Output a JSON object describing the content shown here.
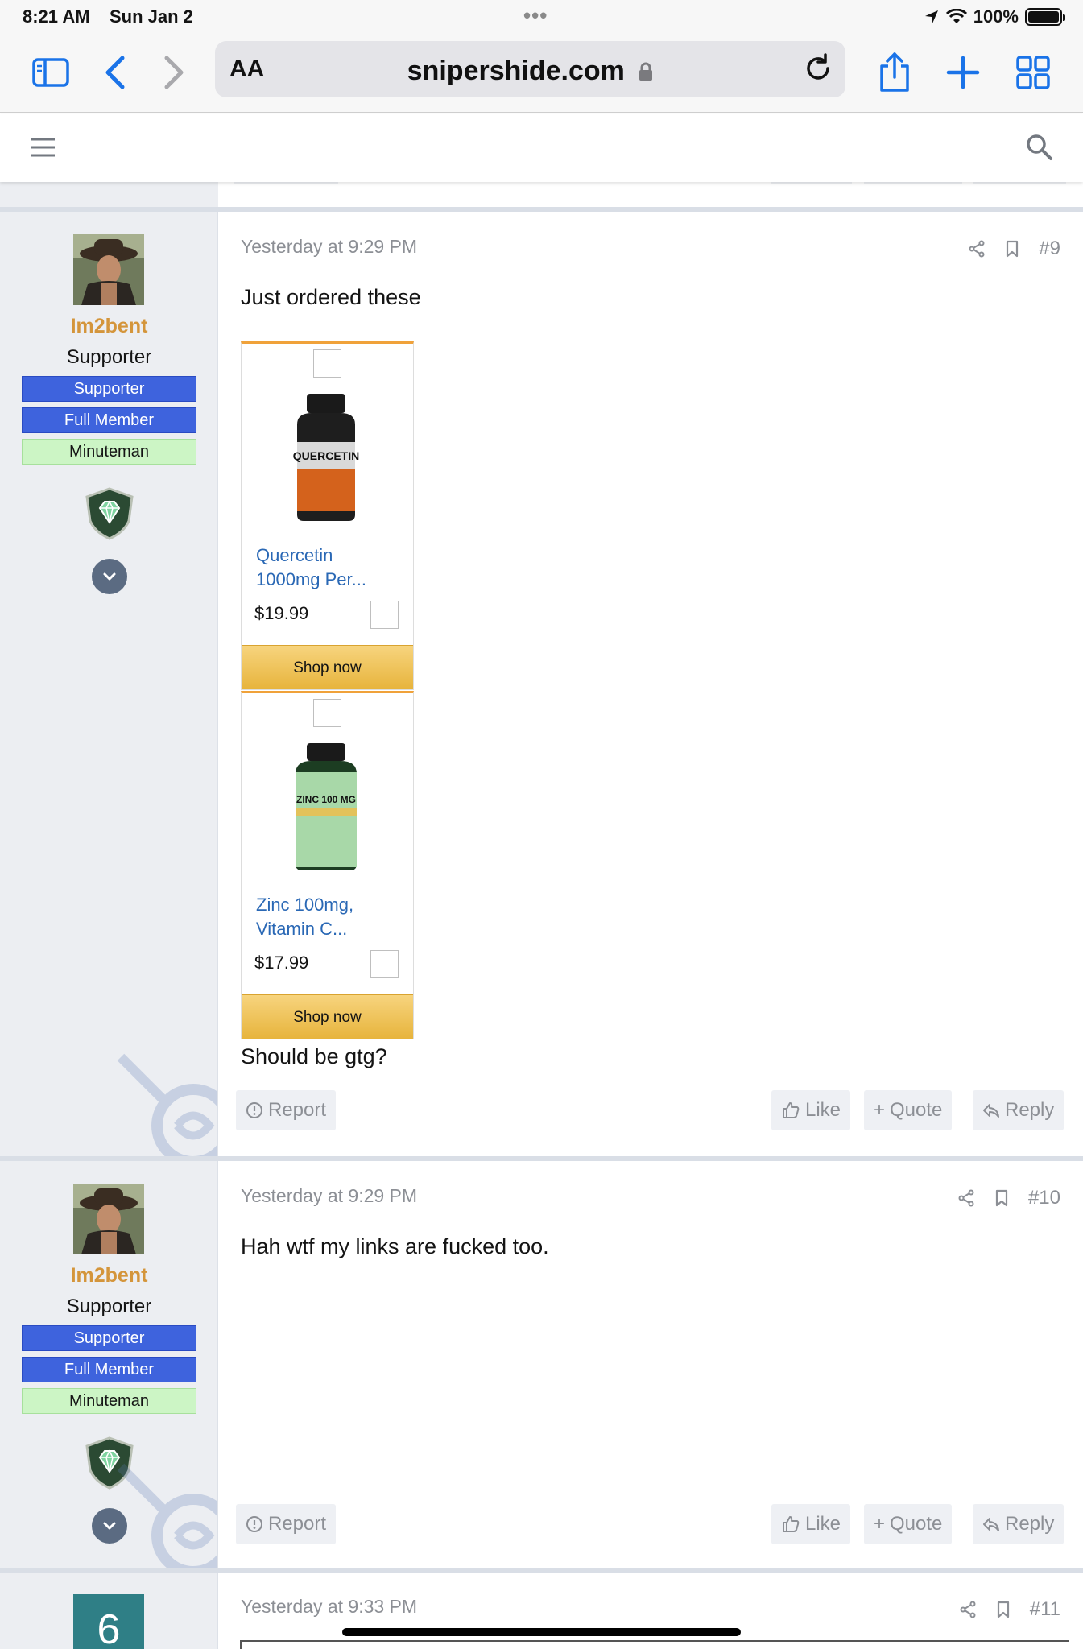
{
  "status_bar": {
    "time": "8:21 AM",
    "date": "Sun Jan 2",
    "dots": "•••",
    "battery": "100%"
  },
  "browser": {
    "text_size_label": "AA",
    "url": "snipershide.com"
  },
  "posts": [
    {
      "date": "Yesterday at 9:29 PM",
      "number": "#9",
      "user": {
        "name": "Im2bent",
        "title": "Supporter",
        "banners": [
          "Supporter",
          "Full Member",
          "Minuteman"
        ]
      },
      "text_before": "Just ordered these",
      "ads": [
        {
          "title": "Quercetin 1000mg Per...",
          "price": "$19.99",
          "button": "Shop now",
          "product_text": "QUERCETIN"
        },
        {
          "title": "Zinc 100mg, Vitamin C...",
          "price": "$17.99",
          "button": "Shop now",
          "product_text": "ZINC 100 MG"
        }
      ],
      "text_after": "Should be gtg?",
      "buttons": {
        "report": "Report",
        "like": "Like",
        "quote": "Quote",
        "reply": "Reply"
      }
    },
    {
      "date": "Yesterday at 9:29 PM",
      "number": "#10",
      "user": {
        "name": "Im2bent",
        "title": "Supporter",
        "banners": [
          "Supporter",
          "Full Member",
          "Minuteman"
        ]
      },
      "text": "Hah wtf my links are fucked too.",
      "buttons": {
        "report": "Report",
        "like": "Like",
        "quote": "Quote",
        "reply": "Reply"
      }
    },
    {
      "date": "Yesterday at 9:33 PM",
      "number": "#11",
      "user": {
        "avatar_letter": "6"
      }
    }
  ],
  "colors": {
    "username": "#d4953b",
    "banner_blue": "#3e63dd",
    "banner_green": "#ccf5c5",
    "link": "#2a68b5",
    "safari_blue": "#1a73e8"
  }
}
